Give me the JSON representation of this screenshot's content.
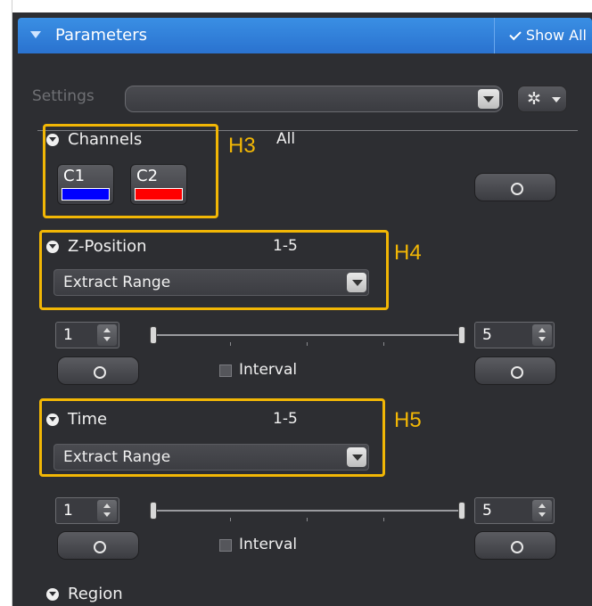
{
  "header": {
    "title": "Parameters",
    "show_all_label": "Show All"
  },
  "settings": {
    "label": "Settings",
    "value": ""
  },
  "channels": {
    "title": "Channels",
    "summary": "All",
    "items": [
      {
        "label": "C1",
        "color": "#0000ff"
      },
      {
        "label": "C2",
        "color": "#ff0000"
      }
    ]
  },
  "zposition": {
    "title": "Z-Position",
    "summary": "1-5",
    "mode": "Extract Range",
    "start": "1",
    "end": "5",
    "interval_label": "Interval"
  },
  "time": {
    "title": "Time",
    "summary": "1-5",
    "mode": "Extract Range",
    "start": "1",
    "end": "5",
    "interval_label": "Interval"
  },
  "region": {
    "title": "Region"
  },
  "annotations": {
    "h3": "H3",
    "h4": "H4",
    "h5": "H5"
  },
  "colors": {
    "accent_highlight": "#f2b705",
    "header_blue": "#2a72cf",
    "panel_bg": "#2d2e32"
  }
}
